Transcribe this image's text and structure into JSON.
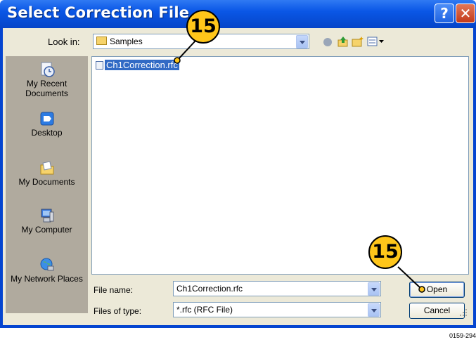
{
  "window": {
    "title": "Select Correction File",
    "help_button": "?",
    "close_button": "✕"
  },
  "lookin": {
    "label": "Look in:",
    "value": "Samples"
  },
  "places": [
    {
      "id": "recent",
      "label": "My Recent Documents"
    },
    {
      "id": "desktop",
      "label": "Desktop"
    },
    {
      "id": "mydocs",
      "label": "My Documents"
    },
    {
      "id": "computer",
      "label": "My Computer"
    },
    {
      "id": "network",
      "label": "My Network Places"
    }
  ],
  "files": [
    {
      "name": "Ch1Correction.rfc",
      "selected": true
    }
  ],
  "filename": {
    "label": "File name:",
    "value": "Ch1Correction.rfc"
  },
  "filetype": {
    "label": "Files of type:",
    "value": "*.rfc (RFC File)"
  },
  "buttons": {
    "open": "Open",
    "cancel": "Cancel"
  },
  "callouts": {
    "top": "15",
    "bottom": "15"
  },
  "caption": "0159-294",
  "colors": {
    "titlebar": "#0a57e6",
    "selection": "#316ac5",
    "callout": "#ffc61a",
    "places_bar": "#b0aa9e"
  }
}
